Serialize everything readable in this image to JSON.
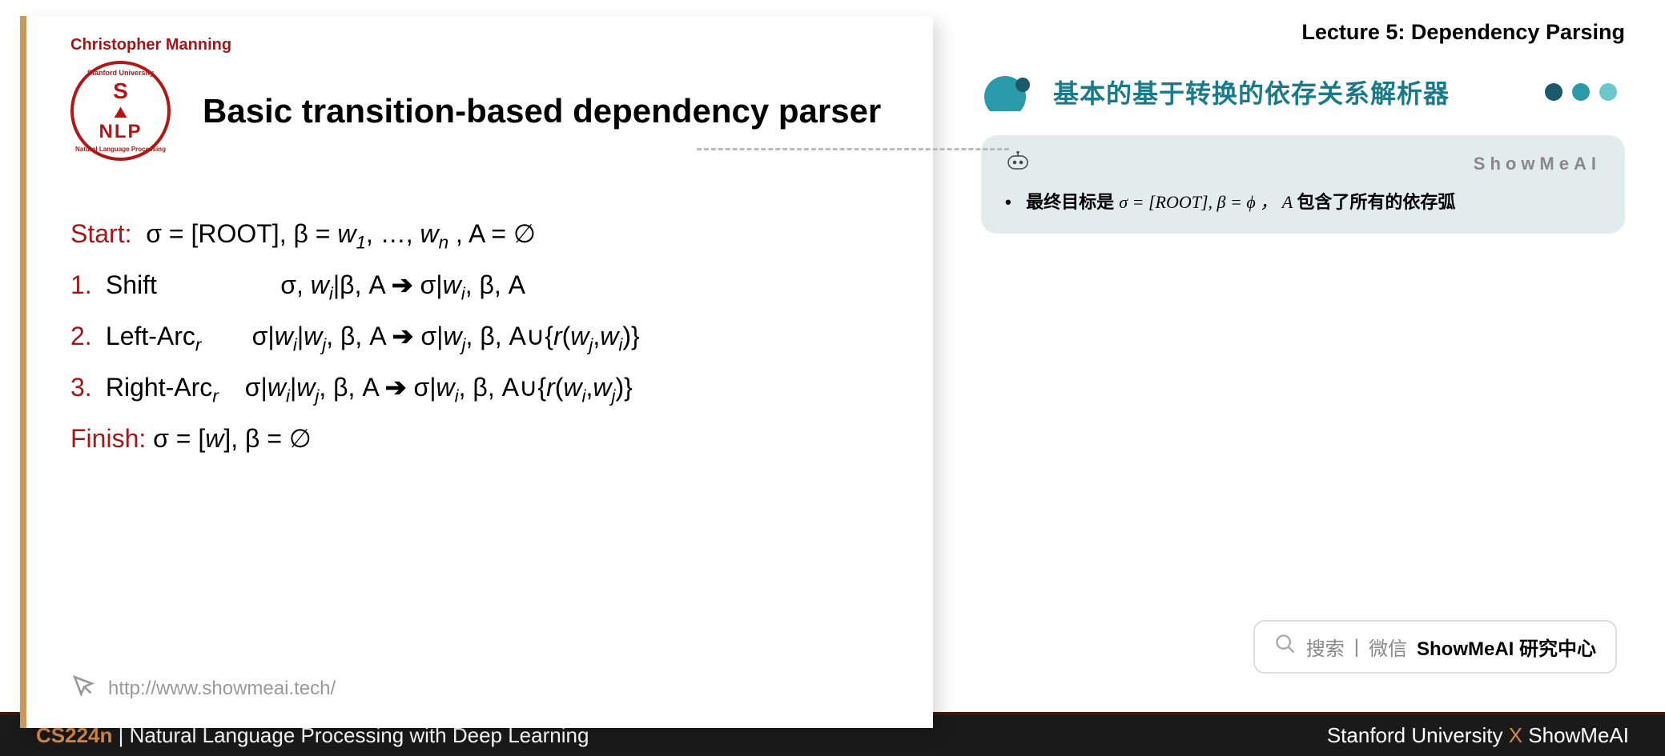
{
  "header": {
    "lecture": "Lecture 5:  Dependency Parsing"
  },
  "slide": {
    "author": "Christopher Manning",
    "logo": {
      "s": "S",
      "nlp": "NLP",
      "top_ring": "Stanford University",
      "bot_ring": "Natural Language Processing"
    },
    "title": "Basic transition-based dependency parser",
    "algo": {
      "start_label": "Start:",
      "start_body": "σ = [ROOT], β = w₁, …, wₙ , A = ∅",
      "r1_num": "1.",
      "r1_op": "Shift",
      "r1_lhs": "σ, wᵢ|β, A",
      "arrow": "➔",
      "r1_rhs": "σ|wᵢ, β, A",
      "r2_num": "2.",
      "r2_op": "Left-Arcᵣ",
      "r2_lhs": "σ|wᵢ|wⱼ, β, A",
      "r2_rhs": "σ|wⱼ, β, A∪{r(wⱼ,wᵢ)}",
      "r3_num": "3.",
      "r3_op": "Right-Arcᵣ",
      "r3_lhs": "σ|wᵢ|wⱼ, β, A",
      "r3_rhs": "σ|wᵢ, β, A∪{r(wᵢ,wⱼ)}",
      "finish_label": "Finish:",
      "finish_body": "σ = [w], β = ∅"
    },
    "url": "http://www.showmeai.tech/"
  },
  "notes": {
    "section_title": "基本的基于转换的依存关系解析器",
    "brand": "ShowMeAI",
    "bullet_prefix": "最终目标是 ",
    "formula": "σ = [ROOT], β = ϕ ， A ",
    "bullet_suffix": "包含了所有的依存弧"
  },
  "search": {
    "text1": "搜索",
    "sep": "|",
    "text2": "微信",
    "bold": "ShowMeAI 研究中心"
  },
  "footer": {
    "course": "CS224n",
    "sep": " | ",
    "subtitle": "Natural Language Processing with Deep Learning",
    "right_pre": "Stanford University ",
    "x": "X",
    "right_post": " ShowMeAI"
  }
}
